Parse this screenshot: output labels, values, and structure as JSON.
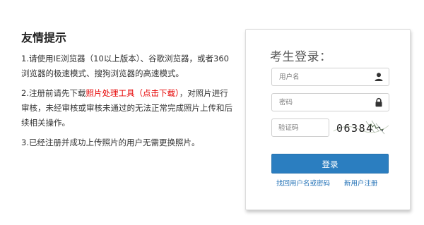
{
  "tips": {
    "title": "友情提示",
    "item1": "1.请使用IE浏览器（10以上版本）、谷歌浏览器，或者360浏览器的极速模式、搜狗浏览器的高速模式。",
    "item2_before": "2.注册前请先下载",
    "item2_link": "照片处理工具（点击下载）",
    "item2_after": "，对照片进行审核，未经审核或审核未通过的无法正常完成照片上传和后续相关操作。",
    "item3": "3.已经注册并成功上传照片的用户无需更换照片。"
  },
  "login": {
    "title": "考生登录：",
    "username_placeholder": "用户名",
    "password_placeholder": "密码",
    "captcha_placeholder": "验证码",
    "captcha_text": "06384",
    "button_label": "登录",
    "recover_link": "找回用户名或密码",
    "register_link": "新用户注册"
  },
  "colors": {
    "accent": "#2b7ec0",
    "link": "#1f6fb5",
    "warning": "#e60000"
  }
}
